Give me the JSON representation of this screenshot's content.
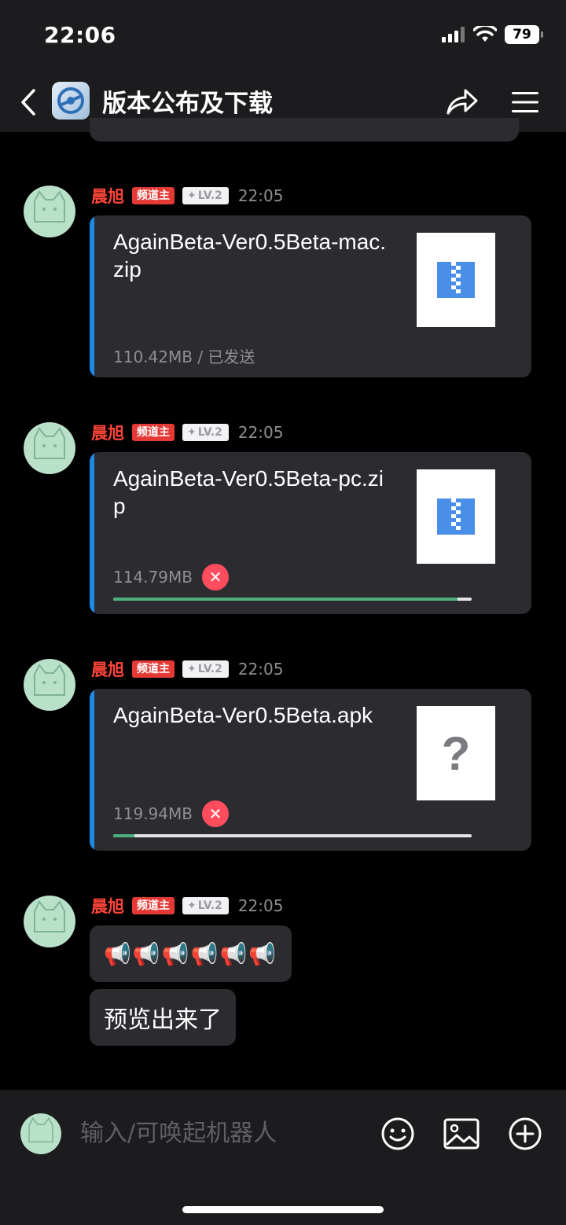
{
  "status_bar": {
    "time": "22:06",
    "battery": "79"
  },
  "header": {
    "title": "版本公布及下载"
  },
  "messages": [
    {
      "user": "晨旭",
      "role": "频道主",
      "level": "LV.2",
      "time": "22:05",
      "file": {
        "name": "AgainBeta-Ver0.5Beta-mac.zip",
        "size": "110.42MB",
        "status": "/ 已发送",
        "icon": "zip-file-icon"
      }
    },
    {
      "user": "晨旭",
      "role": "频道主",
      "level": "LV.2",
      "time": "22:05",
      "file": {
        "name": "AgainBeta-Ver0.5Beta-pc.zip",
        "size": "114.79MB",
        "progress": 0.96,
        "icon": "zip-file-icon"
      }
    },
    {
      "user": "晨旭",
      "role": "频道主",
      "level": "LV.2",
      "time": "22:05",
      "file": {
        "name": "AgainBeta-Ver0.5Beta.apk",
        "size": "119.94MB",
        "progress": 0.06,
        "icon": "unknown-file-icon"
      }
    },
    {
      "user": "晨旭",
      "role": "频道主",
      "level": "LV.2",
      "time": "22:05",
      "texts": [
        "📢📢📢📢📢📢",
        "预览出来了"
      ]
    }
  ],
  "input": {
    "placeholder": "输入/可唤起机器人"
  },
  "colors": {
    "accent": "#1e88e5",
    "progress": "#4caf7d",
    "cancel": "#ff4d5e",
    "name": "#ff453a"
  }
}
